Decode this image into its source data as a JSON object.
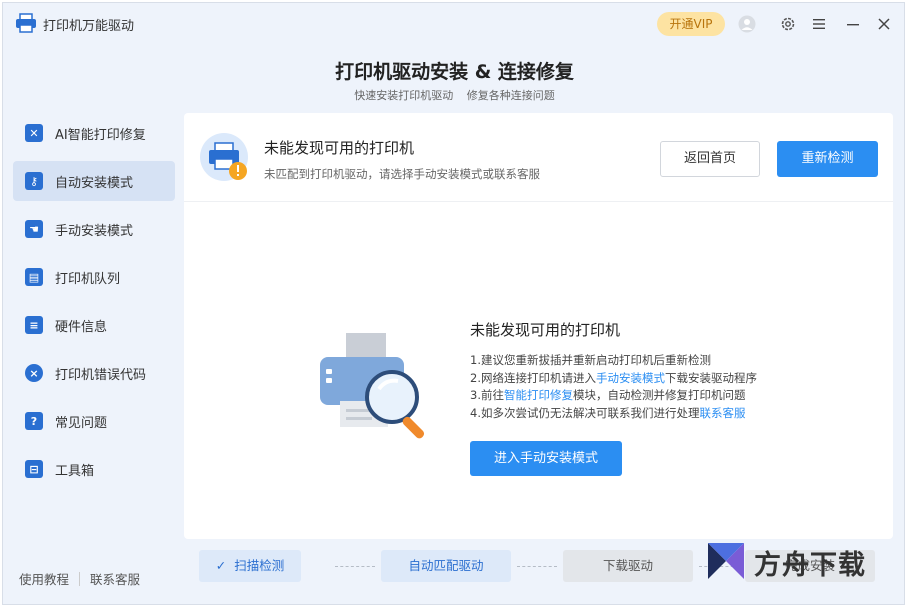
{
  "app": {
    "title": "打印机万能驱动",
    "vip_label": "开通VIP"
  },
  "header": {
    "title": "打印机驱动安装 & 连接修复",
    "subtitle_left": "快速安装打印机驱动",
    "subtitle_right": "修复各种连接问题"
  },
  "sidebar": {
    "items": [
      {
        "label": "AI智能打印修复",
        "icon": "wrench-icon"
      },
      {
        "label": "自动安装模式",
        "icon": "key-icon"
      },
      {
        "label": "手动安装模式",
        "icon": "hand-icon"
      },
      {
        "label": "打印机队列",
        "icon": "printer-icon"
      },
      {
        "label": "硬件信息",
        "icon": "list-icon"
      },
      {
        "label": "打印机错误代码",
        "icon": "error-icon"
      },
      {
        "label": "常见问题",
        "icon": "question-icon"
      },
      {
        "label": "工具箱",
        "icon": "toolbox-icon"
      }
    ],
    "footer_tutorial": "使用教程",
    "footer_support": "联系客服"
  },
  "notice": {
    "title": "未能发现可用的打印机",
    "subtitle": "未匹配到打印机驱动，请选择手动安装模式或联系客服",
    "home_button": "返回首页",
    "recheck_button": "重新检测"
  },
  "help": {
    "title": "未能发现可用的打印机",
    "line1": "1.建议您重新拔插并重新启动打印机后重新检测",
    "line2_pre": "2.网络连接打印机请进入",
    "line2_link": "手动安装模式",
    "line2_post": "下载安装驱动程序",
    "line3_pre": "3.前往",
    "line3_link": "智能打印修复",
    "line3_post": "模块，自动检测并修复打印机问题",
    "line4_pre": "4.如多次尝试仍无法解决可联系我们进行处理",
    "line4_link": "联系客服",
    "enter_button": "进入手动安装模式"
  },
  "steps": [
    {
      "label": "扫描检测",
      "state": "done"
    },
    {
      "label": "自动匹配驱动",
      "state": "done"
    },
    {
      "label": "下载驱动",
      "state": "pending"
    },
    {
      "label": "完成安装",
      "state": "pending"
    }
  ],
  "watermark": {
    "text": "方舟下载"
  },
  "colors": {
    "accent": "#2b8ef2",
    "vip_bg": "#fde3a2",
    "sidebar_active": "#d6e2f4",
    "icon_blue": "#2a6fd1"
  }
}
